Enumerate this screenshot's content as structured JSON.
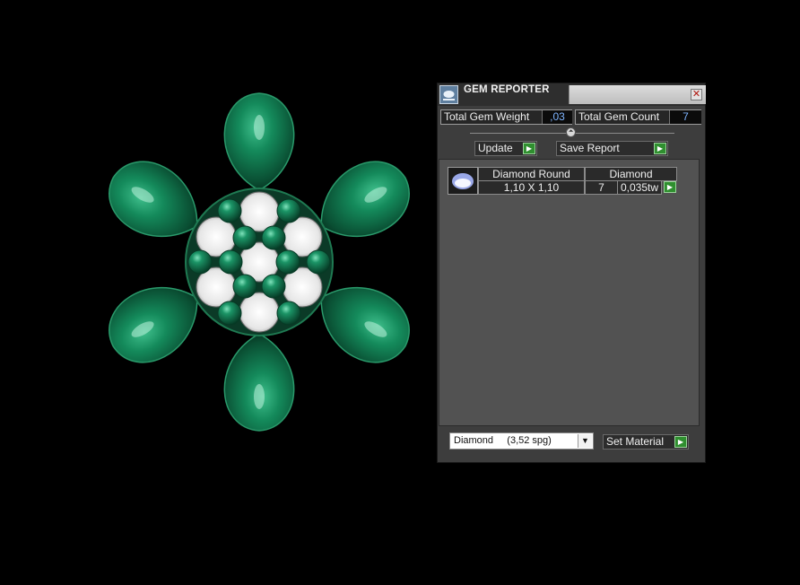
{
  "panel": {
    "title": "GEM REPORTER",
    "close_glyph": "✕",
    "title_icon": "gem-reporter-icon"
  },
  "stats": {
    "total_weight_label": "Total Gem Weight",
    "total_weight_value": ",03",
    "total_count_label": "Total Gem Count",
    "total_count_value": "7"
  },
  "slider": {
    "knob_glyph": "⏶"
  },
  "actions": {
    "update_label": "Update",
    "save_report_label": "Save Report",
    "go_glyph": "▶"
  },
  "gem_list": {
    "rows": [
      {
        "shape": "Diamond Round",
        "material": "Diamond",
        "size": "1,10 X 1,10",
        "count": "7",
        "weight": "0,035tw"
      }
    ]
  },
  "material": {
    "selected": "Diamond     (3,52 spg)",
    "set_label": "Set Material"
  },
  "colors": {
    "gem_green": "#0f6b45",
    "panel_bg": "#3d3d3d",
    "accent_button": "#2f8f2f"
  }
}
